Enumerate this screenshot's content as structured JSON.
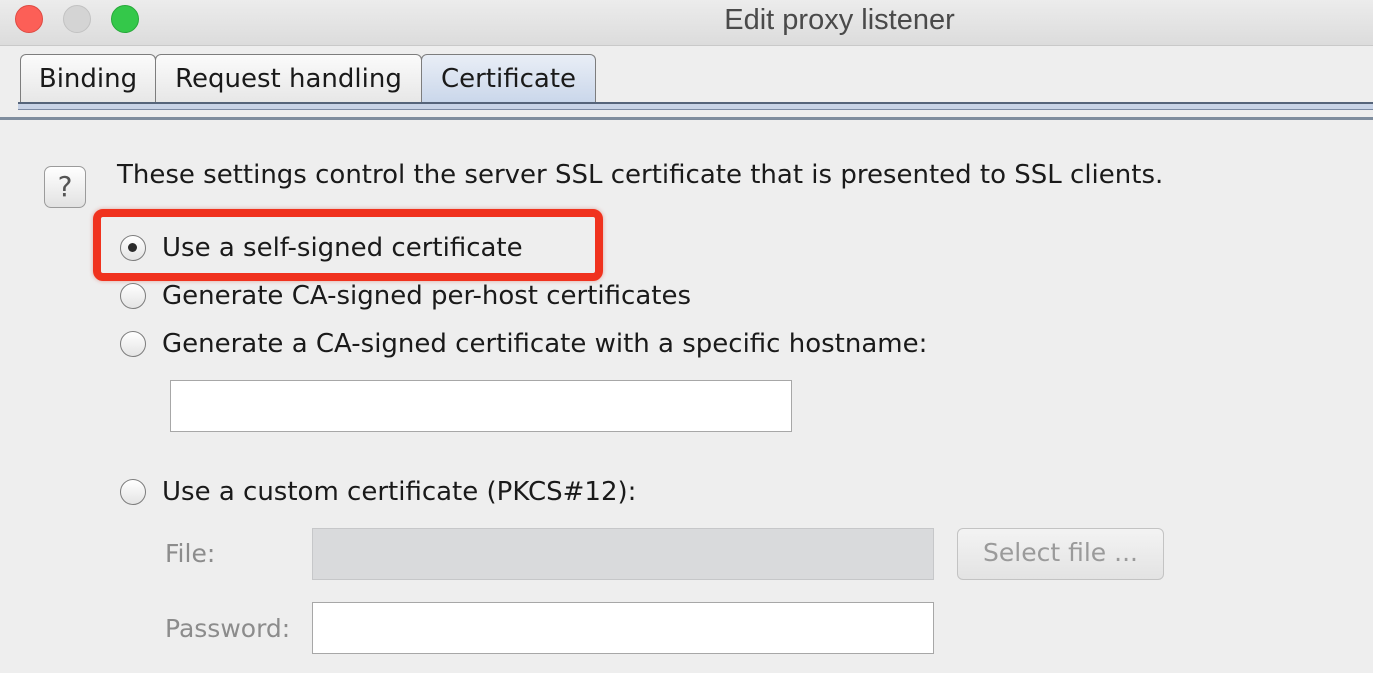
{
  "window": {
    "title": "Edit proxy listener"
  },
  "tabs": [
    {
      "label": "Binding",
      "active": false
    },
    {
      "label": "Request handling",
      "active": false
    },
    {
      "label": "Certificate",
      "active": true
    }
  ],
  "certificate": {
    "help_icon": "question-mark-icon",
    "help_glyph": "?",
    "description": "These settings control the server SSL certificate that is presented to SSL clients.",
    "options": [
      {
        "label": "Use a self-signed certificate",
        "selected": true
      },
      {
        "label": "Generate CA-signed per-host certificates",
        "selected": false
      },
      {
        "label": "Generate a CA-signed certificate with a specific hostname:",
        "selected": false
      },
      {
        "label": "Use a custom certificate (PKCS#12):",
        "selected": false
      }
    ],
    "hostname_value": "",
    "file_label": "File:",
    "file_value": "",
    "select_file_label": "Select file ...",
    "password_label": "Password:",
    "password_value": ""
  },
  "colors": {
    "highlight": "#f0321e",
    "close": "#fc5f57",
    "minimize": "#d4d4d4",
    "maximize": "#34c84a"
  }
}
